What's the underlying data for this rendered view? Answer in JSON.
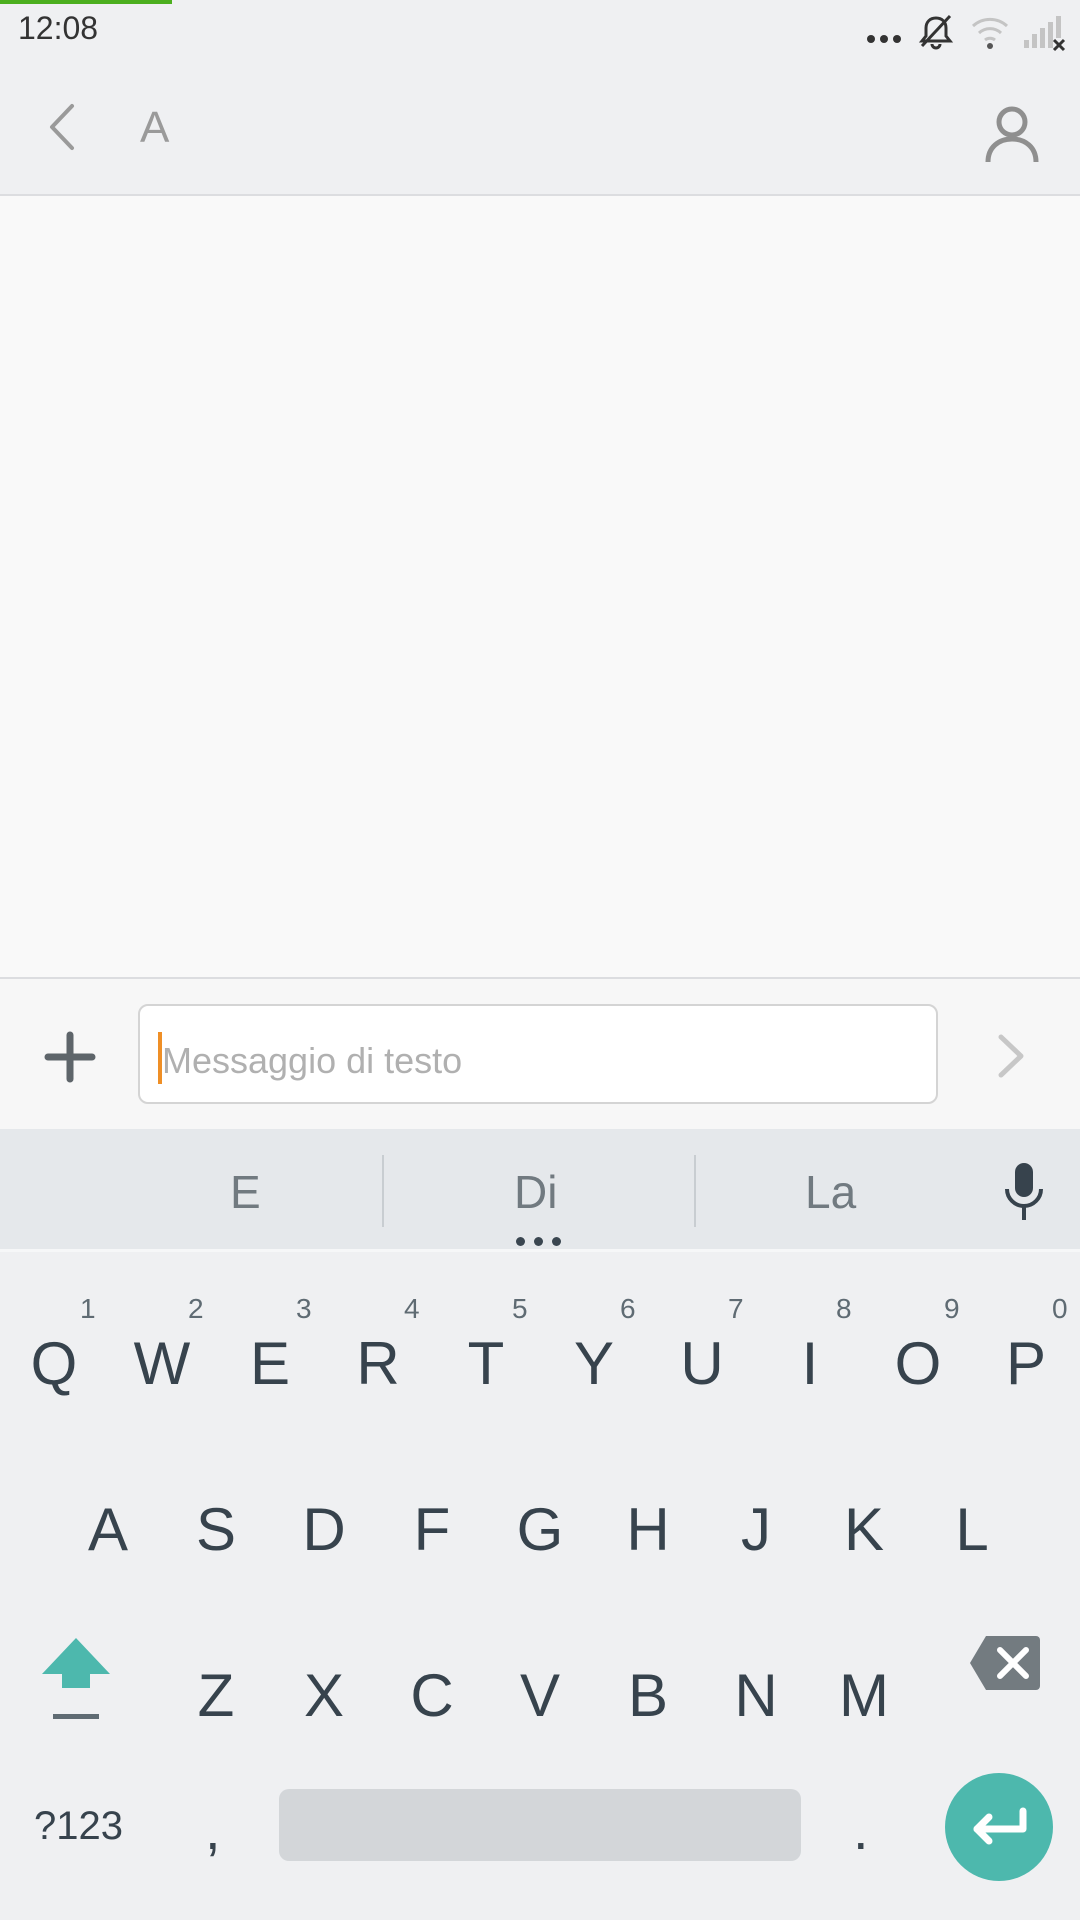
{
  "status_bar": {
    "time": "12:08",
    "icons": [
      "more-dots-icon",
      "muted-bell-icon",
      "wifi-icon",
      "signal-no-service-icon"
    ]
  },
  "app_bar": {
    "contact_name": "A",
    "back_icon": "chevron-left-icon",
    "contact_icon": "person-icon"
  },
  "composer": {
    "placeholder": "Messaggio di testo",
    "value": "",
    "attach_icon": "plus-icon",
    "send_icon": "chevron-right-icon"
  },
  "keyboard": {
    "suggestions": [
      "E",
      "Di",
      "La"
    ],
    "row1": [
      {
        "key": "Q",
        "hint": "1"
      },
      {
        "key": "W",
        "hint": "2"
      },
      {
        "key": "E",
        "hint": "3"
      },
      {
        "key": "R",
        "hint": "4"
      },
      {
        "key": "T",
        "hint": "5"
      },
      {
        "key": "Y",
        "hint": "6"
      },
      {
        "key": "U",
        "hint": "7"
      },
      {
        "key": "I",
        "hint": "8"
      },
      {
        "key": "O",
        "hint": "9"
      },
      {
        "key": "P",
        "hint": "0"
      }
    ],
    "row2": [
      "A",
      "S",
      "D",
      "F",
      "G",
      "H",
      "J",
      "K",
      "L"
    ],
    "row3": [
      "Z",
      "X",
      "C",
      "V",
      "B",
      "N",
      "M"
    ],
    "symbols_label": "?123",
    "comma": ",",
    "period": ".",
    "colors": {
      "shift": "#4db8ad",
      "enter": "#4db8ad",
      "caret": "#ef8f26",
      "backspace": "#737b80"
    }
  }
}
